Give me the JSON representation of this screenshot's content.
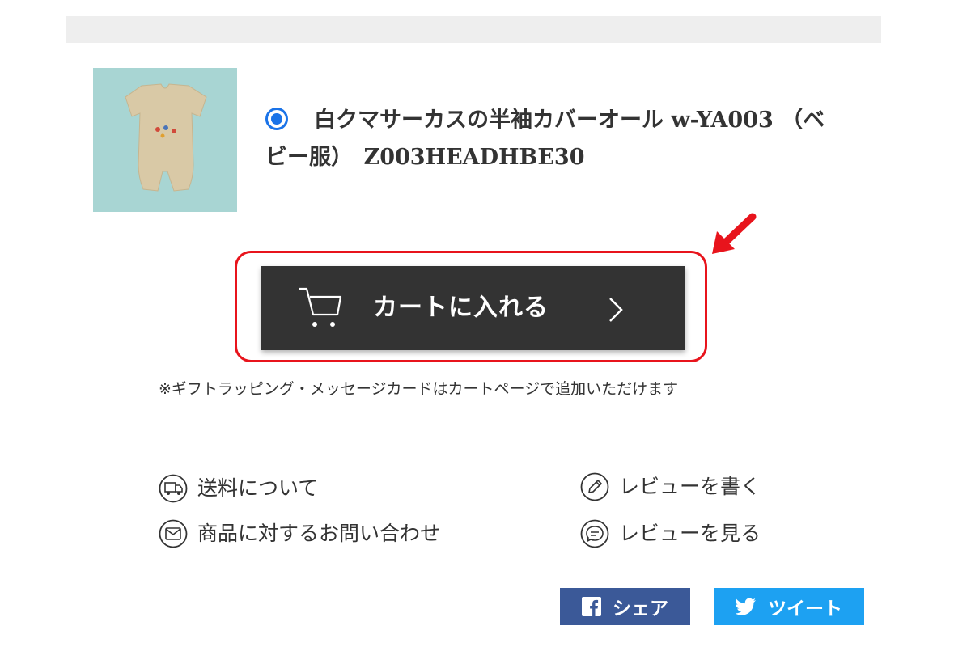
{
  "product": {
    "image_alt": "白クマサーカスの半袖カバーオール",
    "variant_line1": "白クマサーカスの半袖カバーオール w-YA003 （ベ",
    "variant_line2": "ビー服）　Z003HEADHBE30",
    "variant_selected": true
  },
  "cart": {
    "button_label": "カートに入れる",
    "note": "※ギフトラッピング・メッセージカードはカートページで追加いただけます"
  },
  "links": {
    "shipping": "送料について",
    "inquiry": "商品に対するお問い合わせ",
    "write_review": "レビューを書く",
    "view_reviews": "レビューを見る"
  },
  "share": {
    "facebook_label": "シェア",
    "twitter_label": "ツイート"
  },
  "colors": {
    "accent_blue": "#1a73e8",
    "cart_button": "#333333",
    "highlight_red": "#e8141c",
    "facebook": "#3b5998",
    "twitter": "#1da1f2"
  },
  "icons": {
    "cart": "shopping-cart-icon",
    "chevron": "chevron-right-icon",
    "shipping": "truck-icon",
    "inquiry": "mail-icon",
    "write_review": "pencil-icon",
    "view_reviews": "chat-bubble-icon",
    "facebook": "facebook-icon",
    "twitter": "twitter-icon",
    "annotation": "red-arrow-icon"
  }
}
